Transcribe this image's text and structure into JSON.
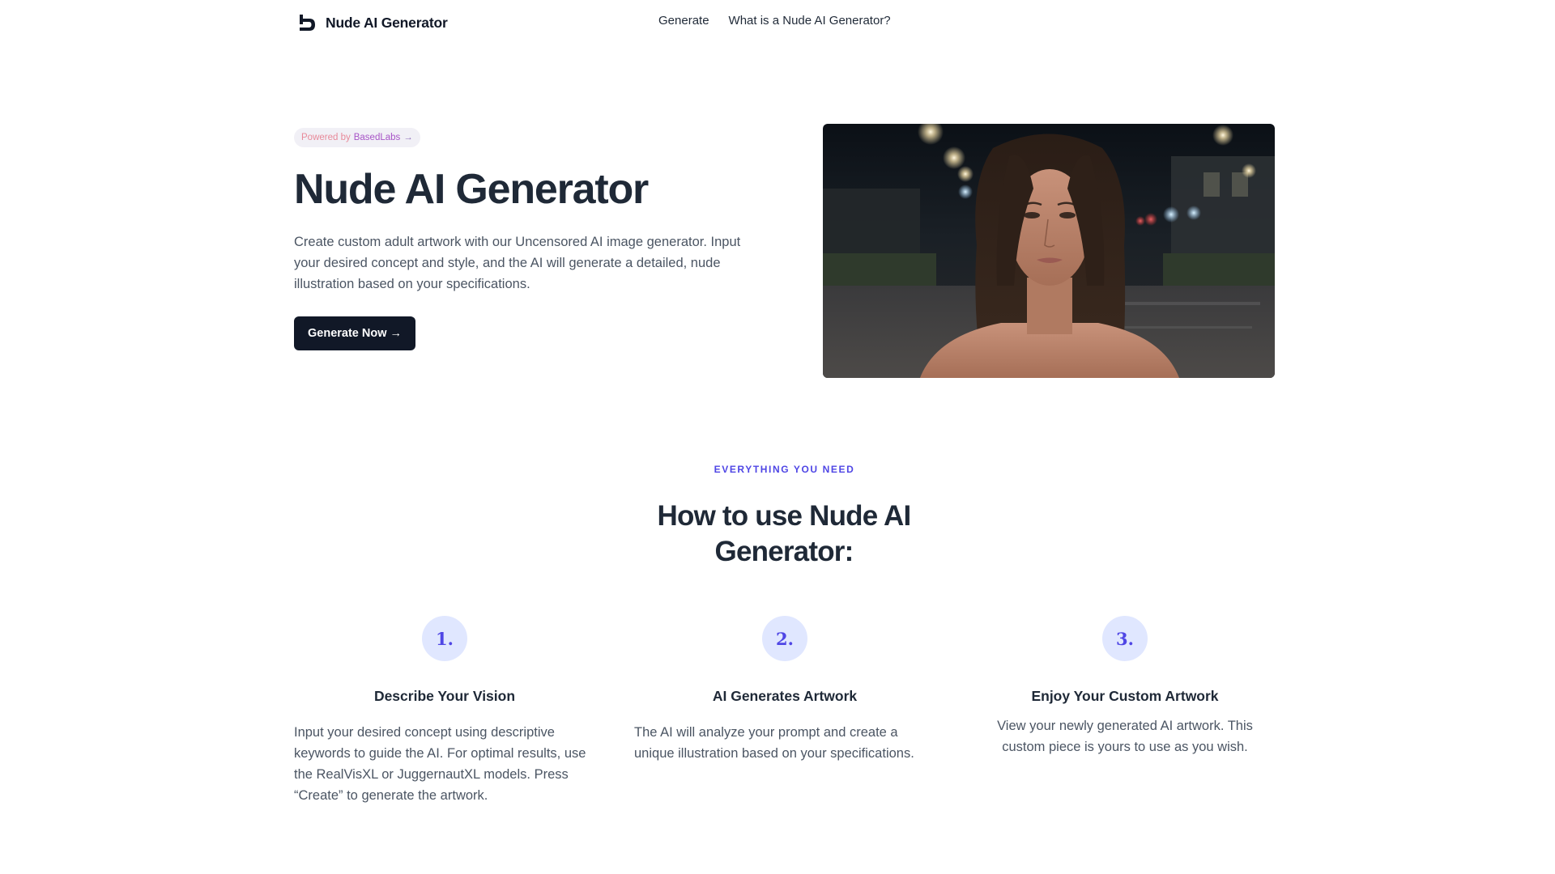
{
  "header": {
    "brand_name": "Nude AI Generator",
    "brand_icon": "basedlabs-logo-icon",
    "nav": [
      {
        "label": "Generate"
      },
      {
        "label": "What is a Nude AI Generator?"
      }
    ]
  },
  "hero": {
    "pill": {
      "prefix": "Powered by",
      "brand": "BasedLabs",
      "arrow": "→"
    },
    "title": "Nude AI Generator",
    "description": "Create custom adult artwork with our Uncensored AI image generator. Input your desired concept and style, and the AI will generate a detailed, nude illustration based on your specifications.",
    "cta_label": "Generate Now →"
  },
  "features": {
    "eyebrow": "EVERYTHING YOU NEED",
    "title": "How to use Nude AI Generator:",
    "steps": [
      {
        "number": "1.",
        "title": "Describe Your Vision",
        "description": "Input your desired concept using descriptive keywords to guide the AI. For optimal results, use the RealVisXL or JuggernautXL models. Press “Create” to generate the artwork."
      },
      {
        "number": "2.",
        "title": "AI Generates Artwork",
        "description": "The AI will analyze your prompt and create a unique illustration based on your specifications."
      },
      {
        "number": "3.",
        "title": "Enjoy Your Custom Artwork",
        "description": "View your newly generated AI artwork. This custom piece is yours to use as you wish."
      }
    ]
  },
  "colors": {
    "accent": "#4f46e5",
    "dark": "#111827",
    "badge_bg": "#e0e7ff",
    "pill_bg": "#f1f0f6"
  }
}
